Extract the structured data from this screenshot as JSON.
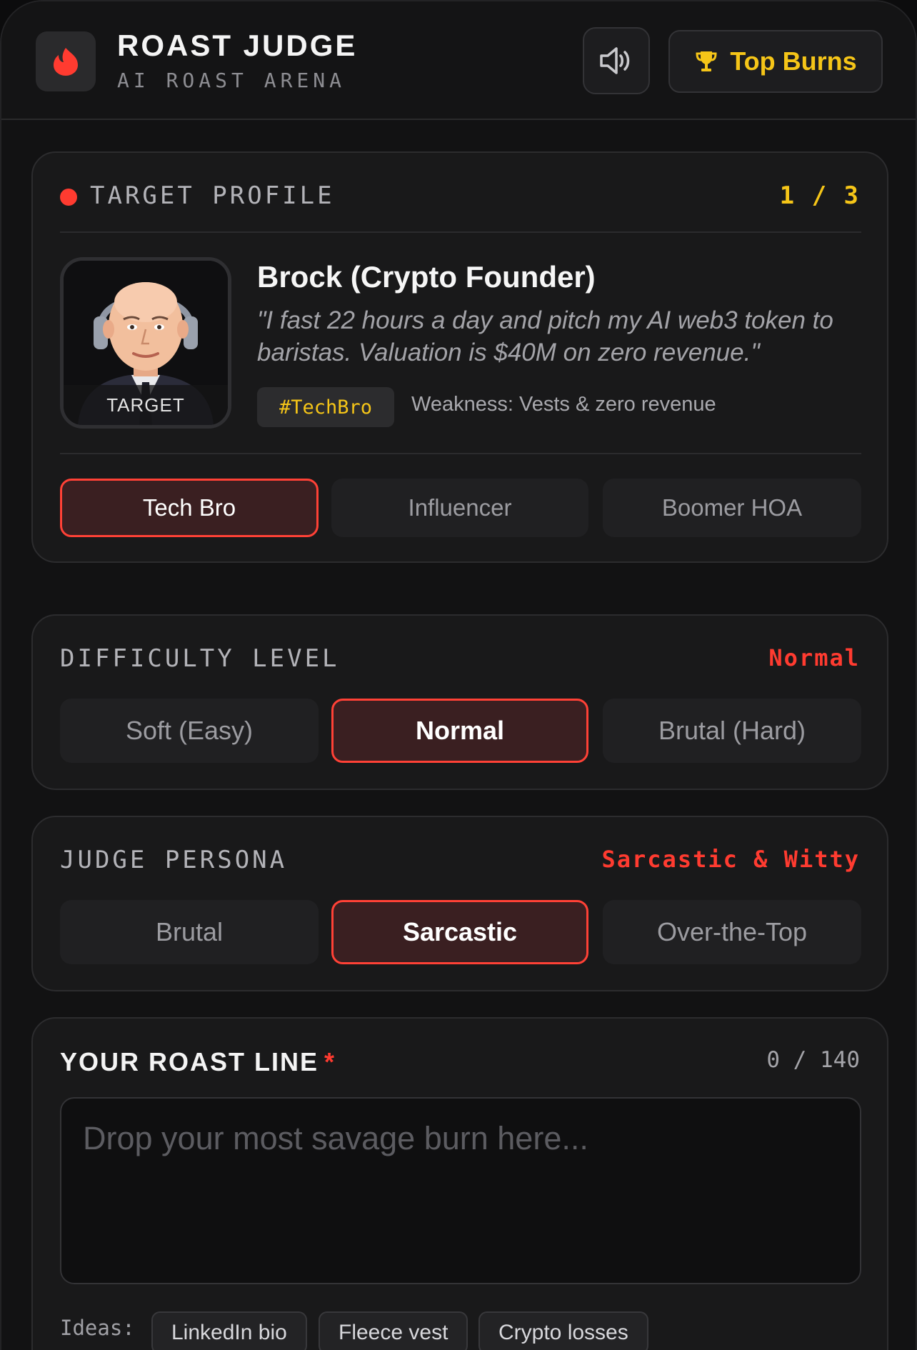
{
  "header": {
    "title": "ROAST JUDGE",
    "subtitle": "AI ROAST ARENA",
    "top_burns_label": "Top Burns"
  },
  "target": {
    "section_label": "TARGET PROFILE",
    "counter": "1 / 3",
    "avatar_caption": "TARGET",
    "name": "Brock (Crypto Founder)",
    "quote": "\"I fast 22 hours a day and pitch my AI web3 token to baristas. Valuation is $40M on zero revenue.\"",
    "tag": "#TechBro",
    "weakness": "Weakness: Vests & zero revenue",
    "options": [
      "Tech Bro",
      "Influencer",
      "Boomer HOA"
    ],
    "selected": "Tech Bro"
  },
  "difficulty": {
    "label": "DIFFICULTY LEVEL",
    "current": "Normal",
    "options": [
      "Soft (Easy)",
      "Normal",
      "Brutal (Hard)"
    ]
  },
  "judge": {
    "label": "JUDGE PERSONA",
    "current": "Sarcastic & Witty",
    "options": [
      "Brutal",
      "Sarcastic",
      "Over-the-Top"
    ]
  },
  "roast": {
    "title": "YOUR ROAST LINE",
    "required_mark": "*",
    "counter": "0 / 140",
    "placeholder": "Drop your most savage burn here...",
    "ideas_label": "Ideas:",
    "ideas": [
      "LinkedIn bio",
      "Fleece vest",
      "Crypto losses"
    ]
  },
  "colors": {
    "accent_red": "#ff3b30",
    "gold": "#f5c518",
    "bg": "#121213",
    "card": "#19191a"
  },
  "icons": {
    "logo": "flame-icon",
    "sound": "speaker-icon",
    "trophy": "trophy-icon"
  }
}
